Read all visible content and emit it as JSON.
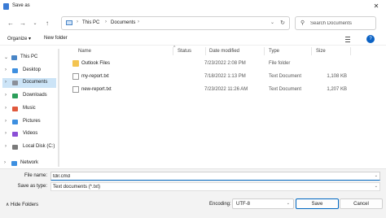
{
  "window": {
    "title": "Save as",
    "close_glyph": "✕"
  },
  "nav": {
    "back": "←",
    "forward": "→",
    "up_menu": "⌄",
    "up": "↑",
    "breadcrumb": [
      "This PC",
      "Documents"
    ],
    "separator": "›",
    "address_dropdown": "⌄",
    "refresh": "↻",
    "search_placeholder": "Search Documents",
    "search_glyph": "⚲"
  },
  "toolbar": {
    "organize": "Organize ▾",
    "new_folder": "New folder",
    "help": "?"
  },
  "sidebar": {
    "items": [
      {
        "label": "This PC",
        "chevron": "⌄",
        "icon_color": "#4a86c7",
        "selected": false
      },
      {
        "label": "Desktop",
        "chevron": "›",
        "icon_color": "#3d8fe0",
        "selected": false
      },
      {
        "label": "Documents",
        "chevron": "›",
        "icon_color": "#8a8f99",
        "selected": true
      },
      {
        "label": "Downloads",
        "chevron": "›",
        "icon_color": "#2b9e5a",
        "selected": false
      },
      {
        "label": "Music",
        "chevron": "›",
        "icon_color": "#e0593d",
        "selected": false
      },
      {
        "label": "Pictures",
        "chevron": "›",
        "icon_color": "#3d8fe0",
        "selected": false
      },
      {
        "label": "Videos",
        "chevron": "›",
        "icon_color": "#8b4fd6",
        "selected": false
      },
      {
        "label": "Local Disk (C:)",
        "chevron": "›",
        "icon_color": "#7a7a7a",
        "selected": false
      },
      {
        "label": "Network",
        "chevron": "›",
        "icon_color": "#3d8fe0",
        "selected": false
      }
    ]
  },
  "columns": {
    "name": "Name",
    "status": "Status",
    "date_modified": "Date modified",
    "type": "Type",
    "size": "Size",
    "collapse": "^"
  },
  "files": [
    {
      "name": "Outlook Files",
      "date": "7/23/2022 2:08 PM",
      "type": "File folder",
      "size": "",
      "kind": "folder"
    },
    {
      "name": "my-report.txt",
      "date": "7/18/2022 1:13 PM",
      "type": "Text Document",
      "size": "1,108 KB",
      "kind": "doc"
    },
    {
      "name": "new-report.txt",
      "date": "7/23/2022 11:26 AM",
      "type": "Text Document",
      "size": "1,207 KB",
      "kind": "doc"
    }
  ],
  "bottom": {
    "file_name_label": "File name:",
    "file_name_value": "tdir.cmd",
    "save_as_type_label": "Save as type:",
    "save_as_type_value": "Text documents (*.txt)",
    "dropdown_glyph": "⌄",
    "hide_folders": "∧  Hide Folders",
    "encoding_label": "Encoding:",
    "encoding_value": "UTF-8",
    "save": "Save",
    "cancel": "Cancel"
  }
}
